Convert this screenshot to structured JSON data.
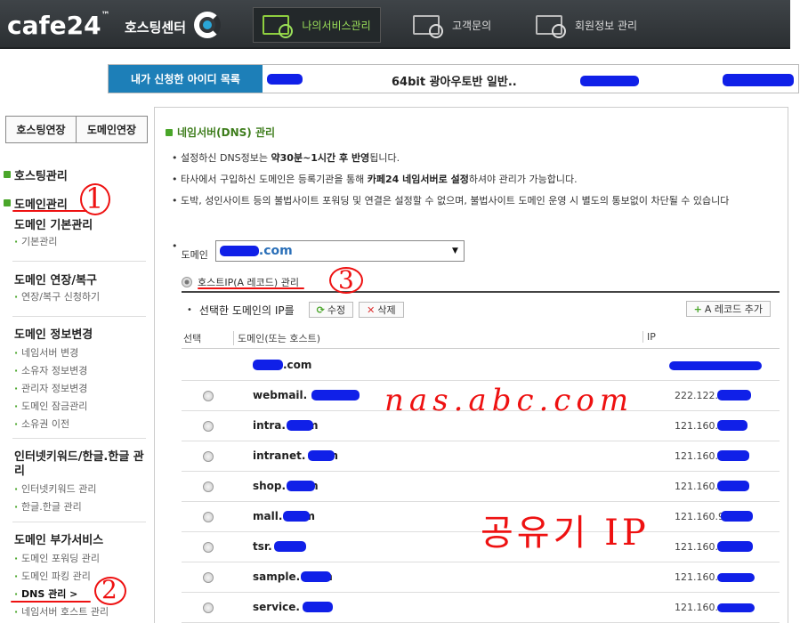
{
  "header": {
    "logo": "cafe24",
    "logo_tm": "™",
    "logo_sub": "호스팅센터",
    "nav": [
      {
        "label": "나의서비스관리",
        "active": true
      },
      {
        "label": "고객문의",
        "active": false
      },
      {
        "label": "회원정보 관리",
        "active": false
      }
    ]
  },
  "id_bar": {
    "label": "내가 신청한 아이디 목록",
    "service": "64bit 광아우토반 일반.."
  },
  "tabs": [
    "호스팅연장",
    "도메인연장"
  ],
  "sidebar": {
    "groups": [
      "호스팅관리",
      "도메인관리"
    ],
    "sections": [
      {
        "title": "도메인 기본관리",
        "items": [
          "기본관리"
        ]
      },
      {
        "title": "도메인 연장/복구",
        "items": [
          "연장/복구 신청하기"
        ]
      },
      {
        "title": "도메인 정보변경",
        "items": [
          "네임서버 변경",
          "소유자 정보변경",
          "관리자 정보변경",
          "도메인 잠금관리",
          "소유권 이전"
        ]
      },
      {
        "title": "인터넷키워드/한글.한글 관리",
        "items": [
          "인터넷키워드 관리",
          "한글.한글 관리"
        ]
      },
      {
        "title": "도메인 부가서비스",
        "items": [
          "도메인 포워딩 관리",
          "도메인 파킹 관리",
          "DNS 관리 >",
          "네임서버 호스트 관리"
        ]
      }
    ]
  },
  "main": {
    "title": "네임서버(DNS) 관리",
    "notes": [
      {
        "pre": "설정하신 DNS정보는 ",
        "bold": "약30분~1시간 후 반영",
        "post": "됩니다."
      },
      {
        "pre": "타사에서 구입하신 도메인은 등록기관을 통해 ",
        "bold": "카페24 네임서버로 설정",
        "post": "하셔야 관리가 가능합니다."
      },
      {
        "pre": "도박, 성인사이트 등의 불법사이트 포워딩 및 연결은 설정할 수 없으며, 불법사이트 도메인 운영 시 별도의 통보없이 차단될 수 있습니다",
        "bold": "",
        "post": ""
      }
    ],
    "domain_label": "도메인",
    "domain_value": ".com",
    "arecord_label": "호스트IP(A 레코드) 관리",
    "ip_title": "선택한 도메인의 IP를",
    "btn_edit": "수정",
    "btn_delete": "삭제",
    "btn_add": "A 레코드 추가",
    "col_select": "선택",
    "col_domain": "도메인(또는 호스트)",
    "col_ip": "IP",
    "rows": [
      {
        "domain": ".com",
        "ip": "",
        "radio": false
      },
      {
        "domain": "webmail.      .com",
        "ip": "222.122.",
        "radio": true
      },
      {
        "domain": "intra.       .com",
        "ip": "121.160.",
        "radio": true
      },
      {
        "domain": "intranet.      .com",
        "ip": "121.160.",
        "radio": true
      },
      {
        "domain": "shop.       .com",
        "ip": "121.160.",
        "radio": true
      },
      {
        "domain": "mall.       .com",
        "ip": "121.160.9",
        "radio": true
      },
      {
        "domain": "tsr.        .com",
        "ip": "121.160.",
        "radio": true
      },
      {
        "domain": "sample.      .com",
        "ip": "121.160.",
        "radio": true
      },
      {
        "domain": "service.      .com",
        "ip": "121.160.",
        "radio": true
      }
    ]
  },
  "annotations": {
    "n1": "1",
    "n2": "2",
    "n3": "3",
    "nas": "nas.abc.com",
    "router": "공유기 IP",
    "color": "#e11111"
  }
}
